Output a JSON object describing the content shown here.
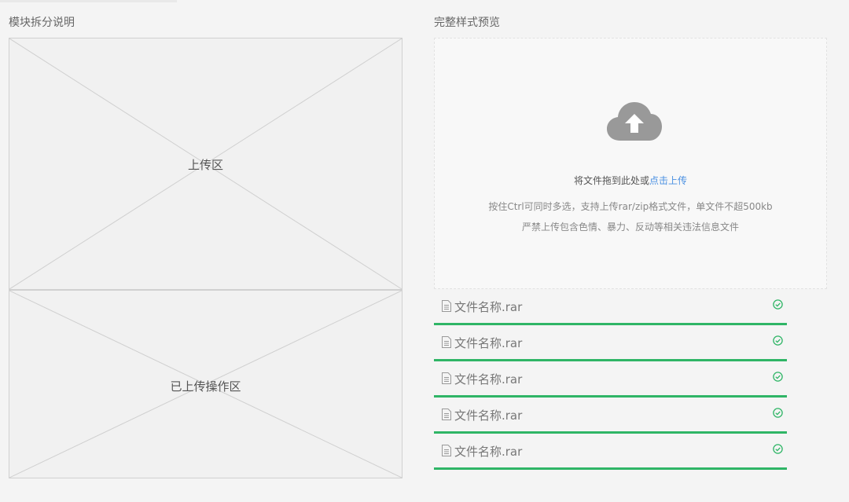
{
  "left_panel": {
    "title": "模块拆分说明",
    "upload_area_label": "上传区",
    "uploaded_ops_label": "已上传操作区"
  },
  "right_panel": {
    "title": "完整样式预览",
    "dropzone": {
      "prompt_text": "将文件拖到此处或",
      "prompt_link": "点击上传",
      "hint_line1": "按住Ctrl可同时多选，支持上传rar/zip格式文件，单文件不超500kb",
      "hint_line2": "严禁上传包含色情、暴力、反动等相关违法信息文件",
      "icon": "cloud-upload-icon"
    },
    "files": [
      {
        "name": "文件名称.rar",
        "status": "success",
        "progress": 1.0
      },
      {
        "name": "文件名称.rar",
        "status": "success",
        "progress": 1.0
      },
      {
        "name": "文件名称.rar",
        "status": "success",
        "progress": 1.0
      },
      {
        "name": "文件名称.rar",
        "status": "success",
        "progress": 1.0
      },
      {
        "name": "文件名称.rar",
        "status": "success",
        "progress": 1.0
      }
    ]
  },
  "colors": {
    "success": "#2fb566",
    "link": "#4a90e2",
    "icon_gray": "#999999"
  }
}
